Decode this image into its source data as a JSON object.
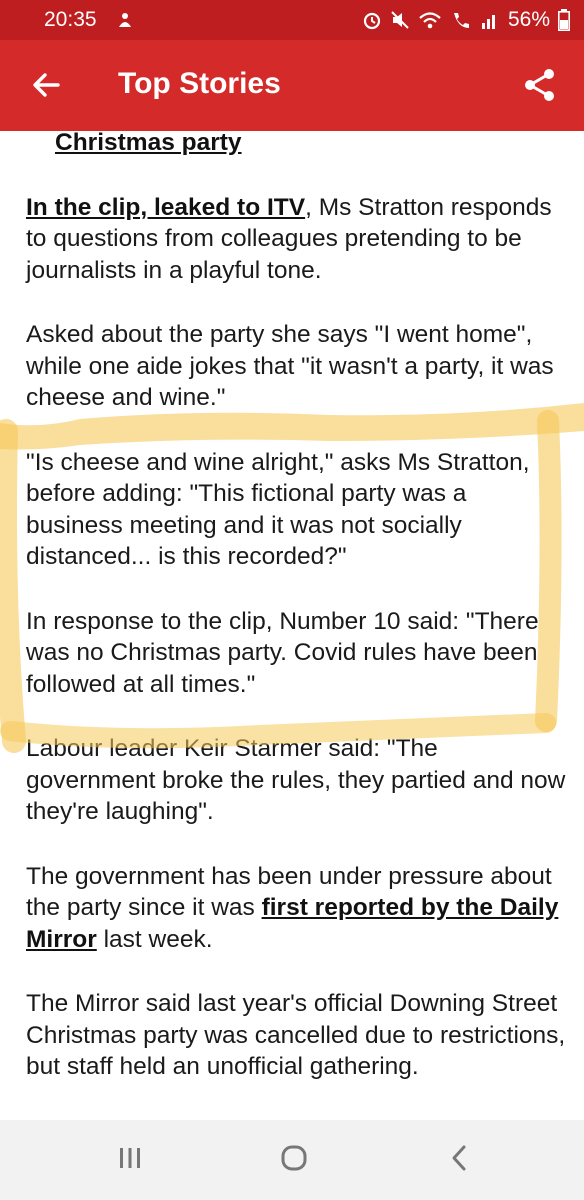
{
  "status_bar": {
    "time": "20:35",
    "battery": "56%",
    "icons": [
      "notification-icon",
      "alarm-icon",
      "mute-icon",
      "wifi-icon",
      "wifi-calling-icon",
      "signal-icon",
      "battery-icon"
    ]
  },
  "app_bar": {
    "title": "Top Stories",
    "back_icon": "back-arrow-icon",
    "share_icon": "share-icon",
    "color": "#d42a29"
  },
  "article": {
    "heading_link": "Christmas party",
    "p1_link": "In the clip, leaked to ITV",
    "p1_text": ", Ms Stratton responds to questions from colleagues pretending to be journalists in a playful tone.",
    "p2": "Asked about the party she says \"I went home\", while one aide jokes that \"it wasn't a party, it was cheese and wine.\"",
    "p3": "\"Is cheese and wine alright,\" asks Ms Stratton, before adding: \"This fictional party was a business meeting and it was not socially distanced... is this recorded?\"",
    "p4": "In response to the clip, Number 10 said: \"There was no Christmas party. Covid rules have been followed at all times.\"",
    "p5": "Labour leader Keir Starmer said: \"The government broke the rules, they partied and now they're laughing\".",
    "p6_before": "The government has been under pressure about the party since it was ",
    "p6_link": "first reported by the Daily Mirror",
    "p6_after": " last week.",
    "p7": "The Mirror said last year's official Downing Street Christmas party was cancelled due to restrictions, but staff held an unofficial gathering."
  },
  "highlight_color": "#f5c85a",
  "nav_bar": {
    "icons": [
      "recent-apps-icon",
      "home-icon",
      "back-icon"
    ]
  }
}
